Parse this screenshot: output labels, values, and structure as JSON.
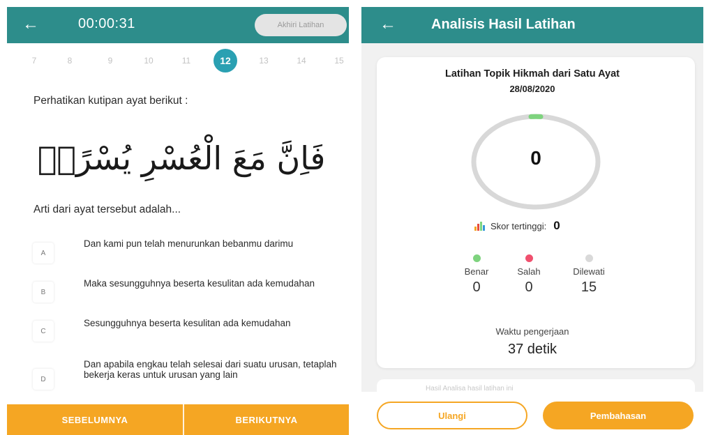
{
  "quiz": {
    "header": {
      "timer": "00:00:31",
      "end_button": "Akhiri Latihan"
    },
    "numbers": [
      "7",
      "8",
      "9",
      "10",
      "11",
      "12",
      "13",
      "14",
      "15"
    ],
    "active_number": "12",
    "prompt": "Perhatikan kutipan ayat berikut :",
    "ayat": "فَاِنَّ مَعَ الْعُسْرِ يُسْرًاۙ",
    "question": "Arti dari ayat tersebut adalah...",
    "options": [
      {
        "letter": "A",
        "text": "Dan kami pun telah menurunkan bebanmu darimu"
      },
      {
        "letter": "B",
        "text": "Maka sesungguhnya beserta kesulitan ada kemudahan"
      },
      {
        "letter": "C",
        "text": "Sesungguhnya beserta kesulitan ada kemudahan"
      },
      {
        "letter": "D",
        "text": "Dan apabila engkau telah selesai dari suatu urusan, tetaplah bekerja keras untuk urusan yang lain"
      }
    ],
    "footer": {
      "prev": "SEBELUMNYA",
      "next": "BERIKUTNYA"
    }
  },
  "result": {
    "header": {
      "title": "Analisis Hasil Latihan"
    },
    "title": "Latihan Topik Hikmah dari Satu Ayat",
    "date": "28/08/2020",
    "score": "0",
    "best_label": "Skor tertinggi:",
    "best_value": "0",
    "stats": [
      {
        "label": "Benar",
        "value": "0",
        "color": "#7ed37e"
      },
      {
        "label": "Salah",
        "value": "0",
        "color": "#f0506e"
      },
      {
        "label": "Dilewati",
        "value": "15",
        "color": "#d9d9d9"
      }
    ],
    "duration_label": "Waktu pengerjaan",
    "duration_value": "37 detik",
    "note": "Hasil Analisa hasil latihan ini",
    "buttons": {
      "retry": "Ulangi",
      "discussion": "Pembahasan"
    }
  },
  "colors": {
    "teal": "#2d8d8b",
    "orange": "#f5a623",
    "active_number": "#2aa0b2"
  }
}
